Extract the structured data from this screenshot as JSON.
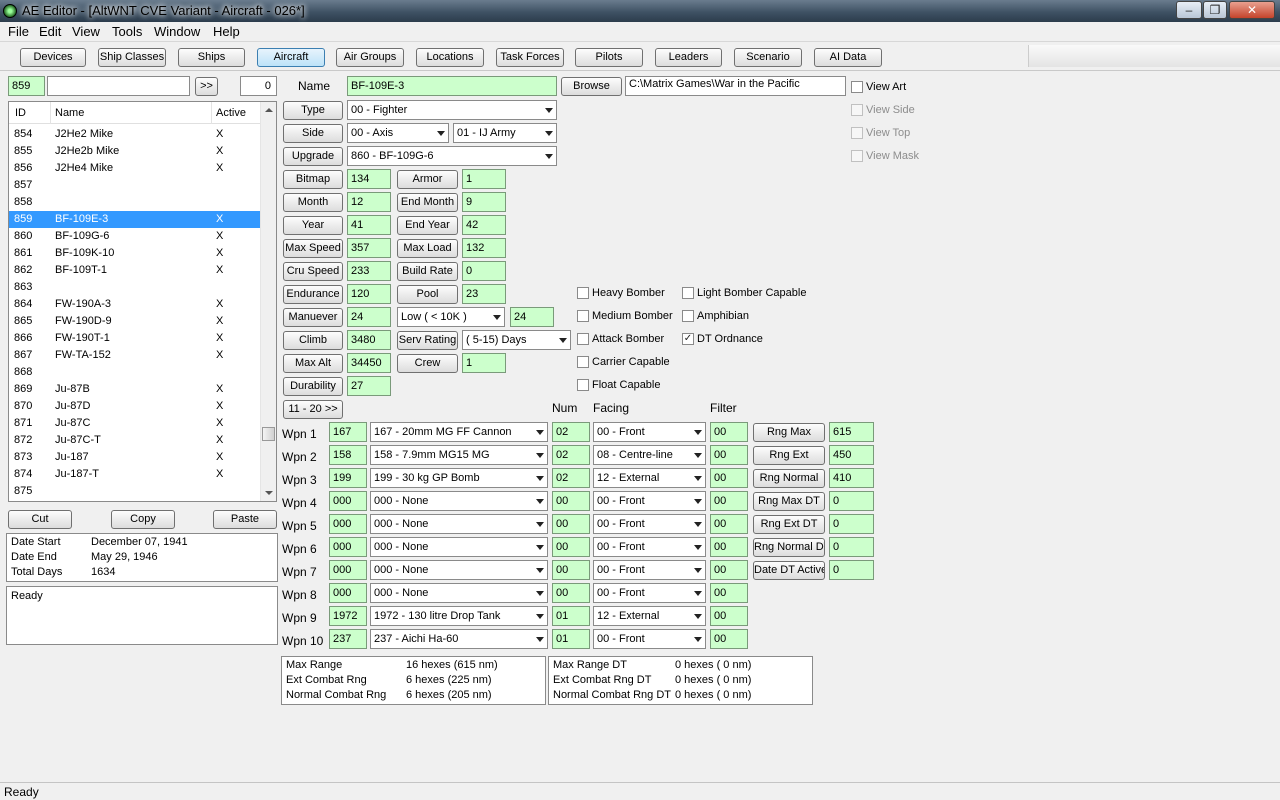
{
  "window": {
    "title": "AE Editor - [AltWNT CVE Variant - Aircraft - 026*]",
    "minimize": "‒",
    "maximize": "❐",
    "close": "✕"
  },
  "menu": [
    "File",
    "Edit",
    "View",
    "Tools",
    "Window",
    "Help"
  ],
  "toolbar": [
    "Devices",
    "Ship Classes",
    "Ships",
    "Aircraft",
    "Air Groups",
    "Locations",
    "Task Forces",
    "Pilots",
    "Leaders",
    "Scenario",
    "AI Data"
  ],
  "toolbar_active": "Aircraft",
  "search": {
    "id_value": "859",
    "text_value": "",
    "go_label": ">>",
    "count_value": "0"
  },
  "list": {
    "columns": [
      "ID",
      "Name",
      "Active"
    ],
    "rows": [
      {
        "id": "854",
        "name": "J2He2 Mike",
        "active": "X"
      },
      {
        "id": "855",
        "name": "J2He2b Mike",
        "active": "X"
      },
      {
        "id": "856",
        "name": "J2He4 Mike",
        "active": "X"
      },
      {
        "id": "857",
        "name": "",
        "active": ""
      },
      {
        "id": "858",
        "name": "",
        "active": ""
      },
      {
        "id": "859",
        "name": "BF-109E-3",
        "active": "X"
      },
      {
        "id": "860",
        "name": "BF-109G-6",
        "active": "X"
      },
      {
        "id": "861",
        "name": "BF-109K-10",
        "active": "X"
      },
      {
        "id": "862",
        "name": "BF-109T-1",
        "active": "X"
      },
      {
        "id": "863",
        "name": "",
        "active": ""
      },
      {
        "id": "864",
        "name": "FW-190A-3",
        "active": "X"
      },
      {
        "id": "865",
        "name": "FW-190D-9",
        "active": "X"
      },
      {
        "id": "866",
        "name": "FW-190T-1",
        "active": "X"
      },
      {
        "id": "867",
        "name": "FW-TA-152",
        "active": "X"
      },
      {
        "id": "868",
        "name": "",
        "active": ""
      },
      {
        "id": "869",
        "name": "Ju-87B",
        "active": "X"
      },
      {
        "id": "870",
        "name": "Ju-87D",
        "active": "X"
      },
      {
        "id": "871",
        "name": "Ju-87C",
        "active": "X"
      },
      {
        "id": "872",
        "name": "Ju-87C-T",
        "active": "X"
      },
      {
        "id": "873",
        "name": "Ju-187",
        "active": "X"
      },
      {
        "id": "874",
        "name": "Ju-187-T",
        "active": "X"
      },
      {
        "id": "875",
        "name": "",
        "active": ""
      }
    ],
    "selected_id": "859"
  },
  "clipboard": {
    "cut": "Cut",
    "copy": "Copy",
    "paste": "Paste"
  },
  "dates": {
    "start_label": "Date Start",
    "start_value": "December 07, 1941",
    "end_label": "Date End",
    "end_value": "May 29, 1946",
    "total_label": "Total Days",
    "total_value": "1634"
  },
  "log_text": "Ready",
  "form": {
    "name_label": "Name",
    "name_value": "BF-109E-3",
    "browse_label": "Browse",
    "path_value": "C:\\Matrix Games\\War in the Pacific",
    "type_label": "Type",
    "type_value": "00 - Fighter",
    "side_label": "Side",
    "side_value": "00 - Axis",
    "service_value": "01 - IJ Army",
    "upgrade_label": "Upgrade",
    "upgrade_value": "860 - BF-109G-6",
    "bitmap_label": "Bitmap",
    "bitmap_value": "134",
    "armor_label": "Armor",
    "armor_value": "1",
    "month_label": "Month",
    "month_value": "12",
    "endmonth_label": "End Month",
    "endmonth_value": "9",
    "year_label": "Year",
    "year_value": "41",
    "endyear_label": "End Year",
    "endyear_value": "42",
    "maxspeed_label": "Max Speed",
    "maxspeed_value": "357",
    "maxload_label": "Max Load",
    "maxload_value": "132",
    "cruspeed_label": "Cru Speed",
    "cruspeed_value": "233",
    "buildrate_label": "Build Rate",
    "buildrate_value": "0",
    "endurance_label": "Endurance",
    "endurance_value": "120",
    "pool_label": "Pool",
    "pool_value": "23",
    "manuever_label": "Manuever",
    "manuever_value": "24",
    "alt_band_value": "Low    ( < 10K )",
    "alt_band_manuever": "24",
    "climb_label": "Climb",
    "climb_value": "3480",
    "servrating_label": "Serv Rating",
    "servrating_value": "( 5-15)  Days",
    "maxalt_label": "Max Alt",
    "maxalt_value": "34450",
    "crew_label": "Crew",
    "crew_value": "1",
    "durability_label": "Durability",
    "durability_value": "27",
    "next_weapons_label": "11 - 20 >>"
  },
  "view_options": [
    {
      "label": "View Art",
      "checked": false,
      "enabled": true
    },
    {
      "label": "View Side",
      "checked": false,
      "enabled": false
    },
    {
      "label": "View Top",
      "checked": false,
      "enabled": false
    },
    {
      "label": "View Mask",
      "checked": false,
      "enabled": false
    }
  ],
  "capabilities_left": [
    {
      "label": "Heavy Bomber",
      "checked": false
    },
    {
      "label": "Medium Bomber",
      "checked": false
    },
    {
      "label": "Attack Bomber",
      "checked": false
    },
    {
      "label": "Carrier Capable",
      "checked": false
    },
    {
      "label": "Float Capable",
      "checked": false
    }
  ],
  "capabilities_right": [
    {
      "label": "Light Bomber Capable",
      "checked": false
    },
    {
      "label": "Amphibian",
      "checked": false
    },
    {
      "label": "DT Ordnance",
      "checked": true
    }
  ],
  "weapons_headers": {
    "num": "Num",
    "facing": "Facing",
    "filter": "Filter"
  },
  "weapons": [
    {
      "label": "Wpn 1",
      "id": "167",
      "device": "167 - 20mm MG FF Cannon",
      "num": "02",
      "facing": "00 - Front",
      "filter": "00"
    },
    {
      "label": "Wpn 2",
      "id": "158",
      "device": "158 - 7.9mm MG15 MG",
      "num": "02",
      "facing": "08 - Centre-line",
      "filter": "00"
    },
    {
      "label": "Wpn 3",
      "id": "199",
      "device": "199 - 30 kg GP Bomb",
      "num": "02",
      "facing": "12 - External",
      "filter": "00"
    },
    {
      "label": "Wpn 4",
      "id": "000",
      "device": "000 - None",
      "num": "00",
      "facing": "00 - Front",
      "filter": "00"
    },
    {
      "label": "Wpn 5",
      "id": "000",
      "device": "000 - None",
      "num": "00",
      "facing": "00 - Front",
      "filter": "00"
    },
    {
      "label": "Wpn 6",
      "id": "000",
      "device": "000 - None",
      "num": "00",
      "facing": "00 - Front",
      "filter": "00"
    },
    {
      "label": "Wpn 7",
      "id": "000",
      "device": "000 - None",
      "num": "00",
      "facing": "00 - Front",
      "filter": "00"
    },
    {
      "label": "Wpn 8",
      "id": "000",
      "device": "000 - None",
      "num": "00",
      "facing": "00 - Front",
      "filter": "00"
    },
    {
      "label": "Wpn 9",
      "id": "1972",
      "device": "1972 - 130 litre Drop Tank",
      "num": "01",
      "facing": "12 - External",
      "filter": "00"
    },
    {
      "label": "Wpn 10",
      "id": "237",
      "device": "237 - Aichi Ha-60",
      "num": "01",
      "facing": "00 - Front",
      "filter": "00"
    }
  ],
  "ranges": [
    {
      "label": "Rng Max",
      "value": "615"
    },
    {
      "label": "Rng Ext",
      "value": "450"
    },
    {
      "label": "Rng Normal",
      "value": "410"
    },
    {
      "label": "Rng Max DT",
      "value": "0"
    },
    {
      "label": "Rng Ext DT",
      "value": "0"
    },
    {
      "label": "Rng Normal DT",
      "value": "0"
    },
    {
      "label": "Date DT Active",
      "value": "0"
    }
  ],
  "range_summary": {
    "left": [
      {
        "label": "Max Range",
        "value": "16 hexes (615 nm)"
      },
      {
        "label": "Ext Combat Rng",
        "value": "6 hexes (225 nm)"
      },
      {
        "label": "Normal Combat Rng",
        "value": "6 hexes (205 nm)"
      }
    ],
    "right": [
      {
        "label": "Max Range DT",
        "value": "0 hexes ( 0 nm)"
      },
      {
        "label": "Ext Combat Rng DT",
        "value": "0 hexes ( 0 nm)"
      },
      {
        "label": "Normal Combat Rng DT",
        "value": "0 hexes ( 0 nm)"
      }
    ]
  },
  "status": "Ready"
}
